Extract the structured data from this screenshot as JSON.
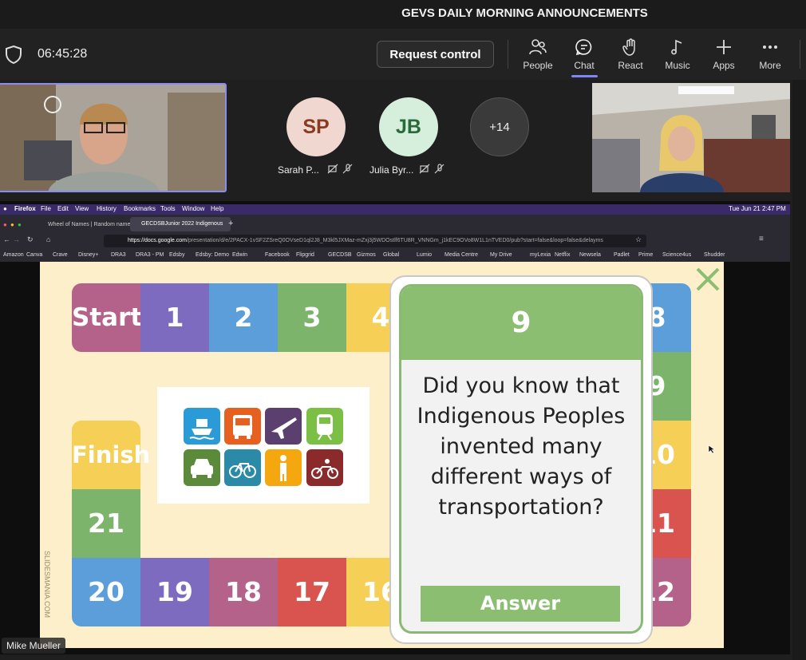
{
  "meeting": {
    "title": "GEVS DAILY MORNING ANNOUNCEMENTS",
    "elapsed": "06:45:28",
    "request_control": "Request control"
  },
  "toolbar": [
    {
      "id": "people",
      "label": "People",
      "icon": "people-icon"
    },
    {
      "id": "chat",
      "label": "Chat",
      "icon": "chat-icon"
    },
    {
      "id": "react",
      "label": "React",
      "icon": "hand-icon"
    },
    {
      "id": "music",
      "label": "Music",
      "icon": "music-icon"
    },
    {
      "id": "apps",
      "label": "Apps",
      "icon": "plus-icon"
    },
    {
      "id": "more",
      "label": "More",
      "icon": "ellipsis-icon"
    }
  ],
  "participants": [
    {
      "initials": "SP",
      "name": "Sarah P...",
      "bg": "#f0d8d0",
      "fg": "#8a3a20"
    },
    {
      "initials": "JB",
      "name": "Julia Byr...",
      "bg": "#d6eedc",
      "fg": "#2a6a3a"
    },
    {
      "initials": "+14",
      "bg": "#3a3a3a",
      "fg": "#eee"
    }
  ],
  "presenter_name": "Mike Mueller",
  "browser": {
    "mac_menu": [
      "Firefox",
      "File",
      "Edit",
      "View",
      "History",
      "Bookmarks",
      "Tools",
      "Window",
      "Help"
    ],
    "clock": "Tue Jun 21  2:47 PM",
    "tabs": [
      "Wheel of Names | Random name pi",
      "GECDSBJunior 2022 Indigenous"
    ],
    "url_host": "https://docs.google.com",
    "url_path": "/presentation/d/e/2PACX-1vSF2ZSreQ0OVseD1ql2J8_M3kl5JXMaz-mZxj3j5WDOstlf6TU8R_VNNGm_j1kEC9OVo8W1L1nTVED0/pub?start=false&loop=false&delayms",
    "bookmarks": [
      "Amazon",
      "Canva",
      "Crave",
      "Disney+",
      "DRA3",
      "DRA3 - PM",
      "Edsby",
      "Edsby: Demo",
      "Edwin",
      "Facebook",
      "Flipgrid",
      "GECDSB",
      "Gizmos",
      "Global",
      "Lumio",
      "Media Centre",
      "My Drive",
      "myLexia",
      "Netflix",
      "Newsela",
      "Padlet",
      "Prime",
      "Science4us",
      "Shudder"
    ]
  },
  "board": {
    "top_row": [
      "Start",
      "1",
      "2",
      "3",
      "4",
      "8"
    ],
    "finish": "Finish",
    "side": [
      "21",
      "9",
      "10",
      "11",
      "12"
    ],
    "bottom_row": [
      "20",
      "19",
      "18",
      "17",
      "16"
    ],
    "watermark": "SLIDESMANIA.COM",
    "colors": {
      "purple": "#7d6bbf",
      "blue": "#5b9ed9",
      "green": "#7cb46b",
      "yellow": "#f6cf57",
      "pink": "#b5628a",
      "red": "#d9534f"
    }
  },
  "card": {
    "number": "9",
    "question": "Did you know that Indigenous Peoples invented many different ways of transportation?",
    "answer_label": "Answer"
  },
  "transport_icons": [
    "ship-icon",
    "bus-icon",
    "plane-icon",
    "train-icon",
    "car-icon",
    "bicycle-icon",
    "pedestrian-icon",
    "motorcycle-icon"
  ]
}
